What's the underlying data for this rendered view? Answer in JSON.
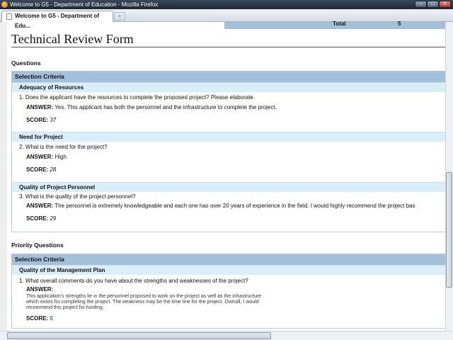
{
  "window": {
    "title": "Welcome to G5 - Department of Education - Mozilla Firefox",
    "tab": "Welcome to G5 - Department of Edu...",
    "new_tab": "+",
    "minimize": "–",
    "maximize": "□",
    "close": "X"
  },
  "total": {
    "label": "Total",
    "value": "5"
  },
  "page_title": "Technical Review Form",
  "questions": {
    "heading": "Questions",
    "criteria": "Selection Criteria",
    "items": [
      {
        "category": "Adequacy of Resources",
        "question": "1. Does the applicant have the resources to complete the proposed project? Please elaborate.",
        "answer_label": "ANSWER:",
        "answer": "Yes.  This applicant has both the personnel and the infrastructure to complete the project.",
        "score_label": "SCORE:",
        "score": "37"
      },
      {
        "category": "Need for Project",
        "question": "2. What is the need for the project?",
        "answer_label": "ANSWER:",
        "answer": "High",
        "score_label": "SCORE:",
        "score": "28"
      },
      {
        "category": "Quality of Project Personnel",
        "question": "3. What is the quality of the project personnel?",
        "answer_label": "ANSWER:",
        "answer": "The personnel is extremely knowledgeable and each one has over 20 years of experience in the field.  I would highly recommend the project bas",
        "score_label": "SCORE:",
        "score": "29"
      }
    ]
  },
  "priority": {
    "heading": "Priority Questions",
    "criteria": "Selection Criteria",
    "category": "Quality of the Management Plan",
    "question": "1. What overall comments do you have about the strengths and weaknesses of the project?",
    "answer_label": "ANSWER:",
    "answer_lines": [
      "This application's strengths lie in the personnel proposed to work on the project as well as the infrastructure",
      "which exists for completing the project.  The weakness may be the time line for the project.  Overall, I would",
      "recommend this project for funding."
    ],
    "score_label": "SCORE:",
    "score": "5"
  },
  "colors": {
    "header": "#a3c0d8",
    "subheader": "#d9eef8"
  }
}
